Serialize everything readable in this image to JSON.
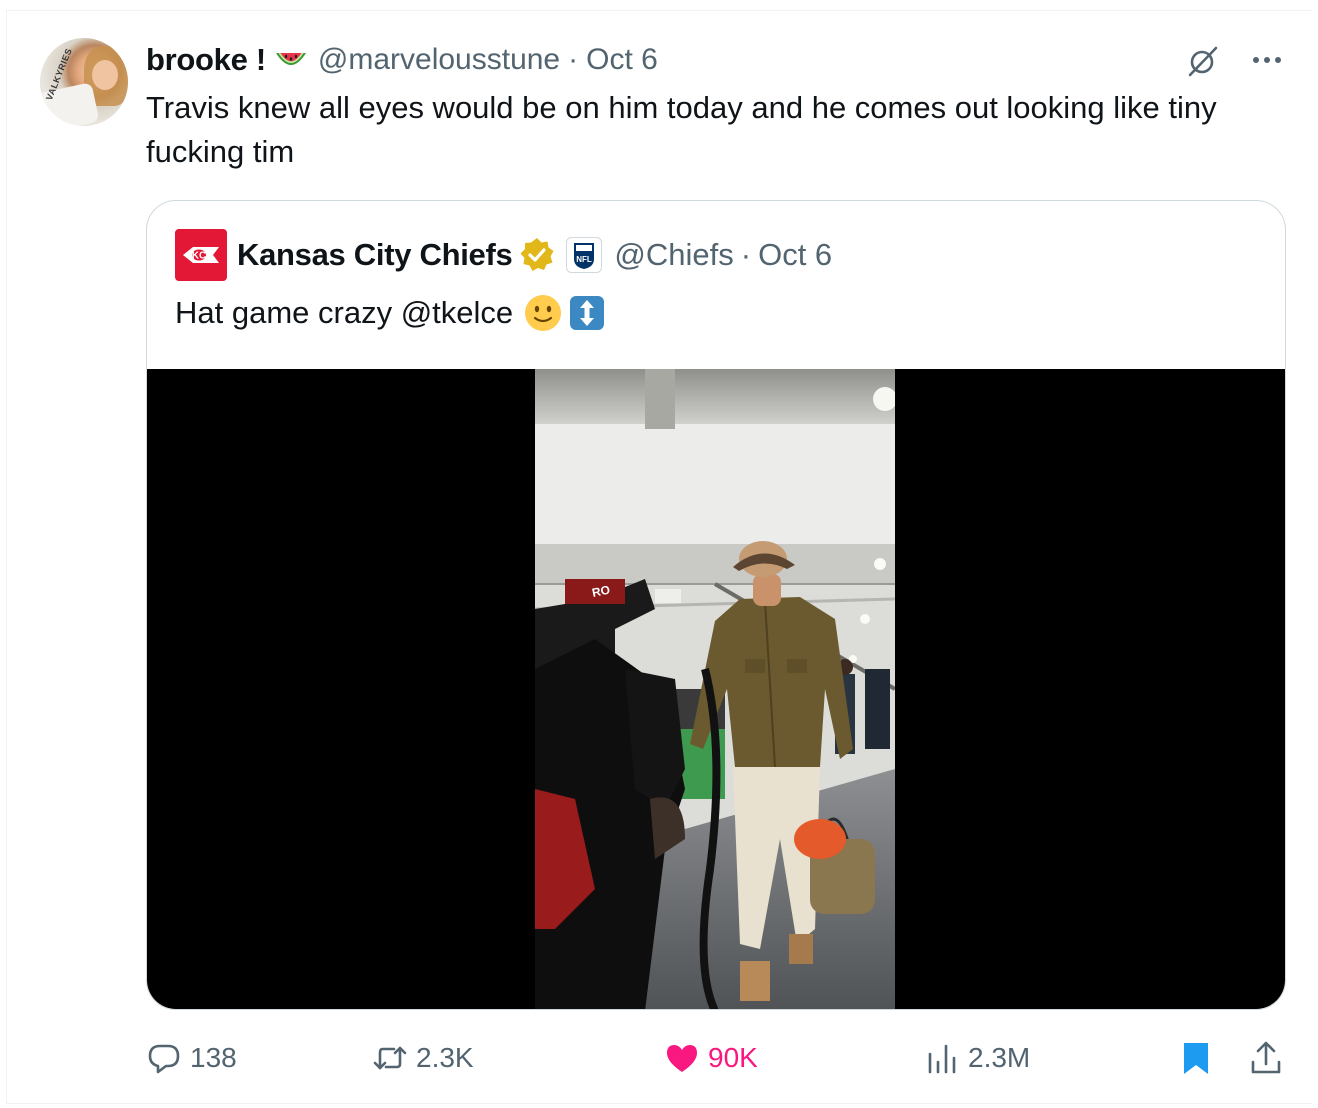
{
  "tweet": {
    "author_name": "brooke !",
    "author_emoji": "watermelon-icon",
    "handle": "@marvelousstune",
    "separator": "·",
    "date": "Oct 6",
    "text": "Travis knew all eyes would be on him today and he comes out looking like tiny fucking tim",
    "avatar_shirt_text": "VALKYRIES"
  },
  "quoted_tweet": {
    "author_name": "Kansas City Chiefs",
    "verified": "gold-checkmark-icon",
    "affiliate_badge": "NFL",
    "handle": "@Chiefs",
    "separator": "·",
    "date": "Oct 6",
    "text": "Hat game crazy @tkelce",
    "emojis": [
      "slightly-smiling-face-icon",
      "up-down-arrow-icon"
    ],
    "video_overlay_text": "RO"
  },
  "actions": {
    "replies": "138",
    "reposts": "2.3K",
    "likes": "90K",
    "views": "2.3M"
  },
  "colors": {
    "text_primary": "#0f1419",
    "text_secondary": "#536471",
    "like_pink": "#f91880",
    "bookmark_blue": "#1d9bf0",
    "border": "#cfd9de",
    "chiefs_red": "#e31837",
    "verified_gold": "#e2b719"
  }
}
